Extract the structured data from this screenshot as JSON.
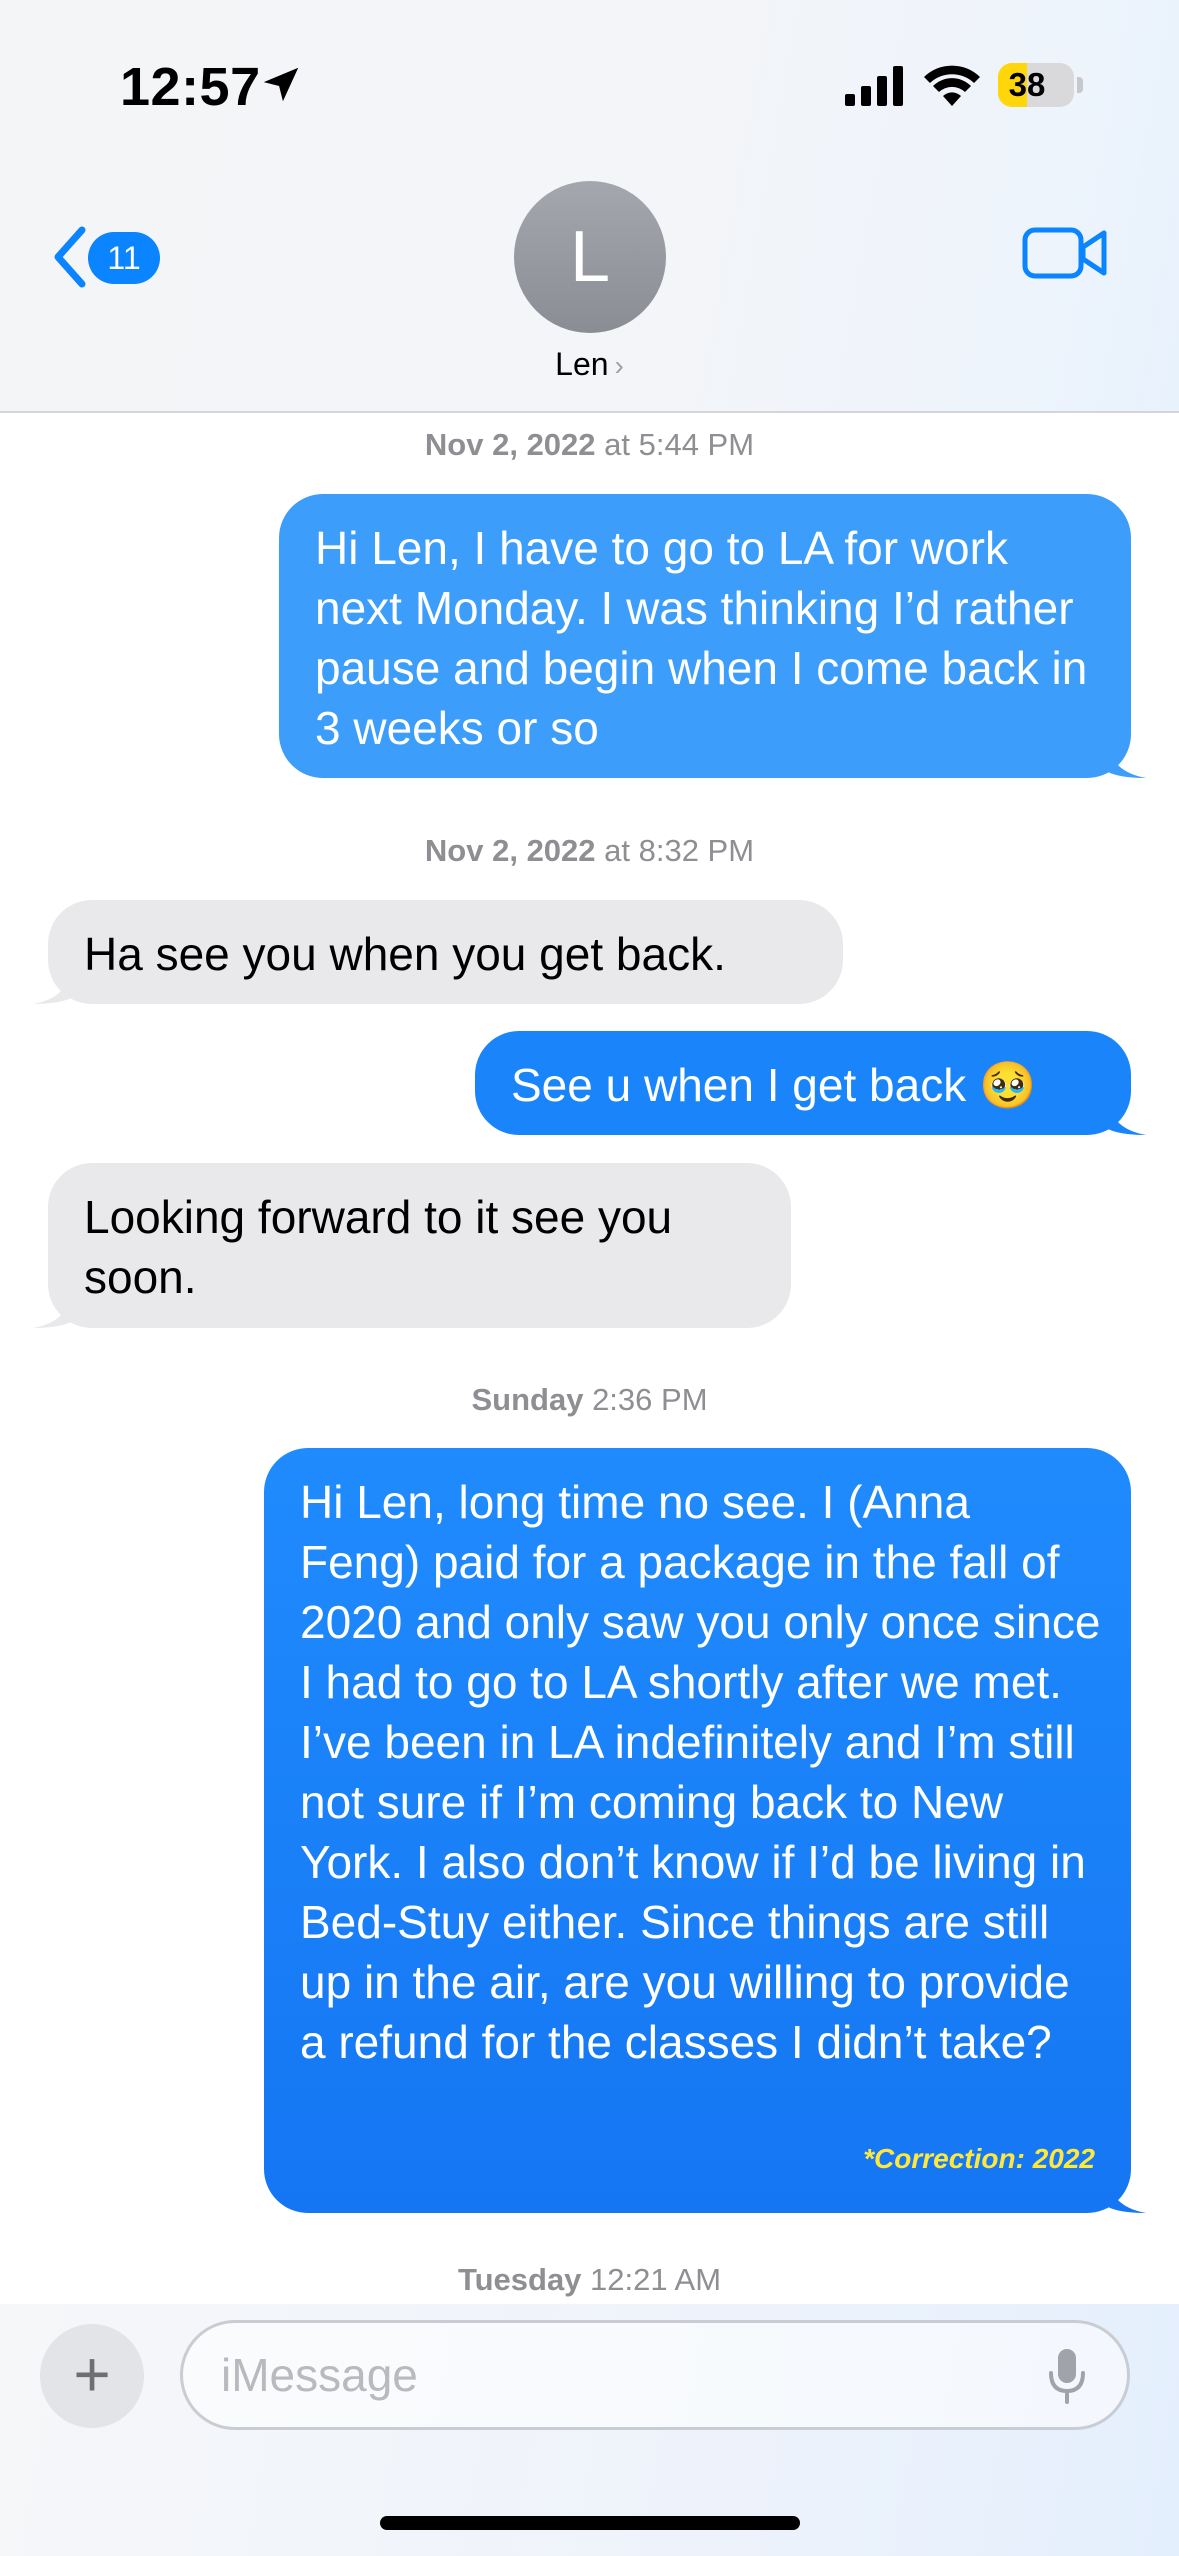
{
  "status_bar": {
    "time": "12:57",
    "battery_level": "38",
    "battery_fraction": 0.38,
    "battery_color": "#ffd60a",
    "icons": [
      "location-arrow-icon",
      "cellular-signal-icon",
      "wifi-icon",
      "battery-icon"
    ]
  },
  "nav": {
    "back_badge_count": "11",
    "contact_initial": "L",
    "contact_name": "Len",
    "contact_chevron": "›",
    "icons": [
      "back-chevron-icon",
      "video-call-icon"
    ]
  },
  "conversation": {
    "ts1_date": "Nov 2, 2022",
    "ts1_time": " at 5:44 PM",
    "msg1": "Hi Len, I have to go to LA for work next Monday. I was thinking I’d rather pause and begin when I come back in 3 weeks or so",
    "ts2_date": "Nov 2, 2022",
    "ts2_time": " at 8:32 PM",
    "msg2": "Ha see you when you get back.",
    "msg3": "See u when I get back 🥹",
    "msg4": "Looking forward to it see you soon.",
    "ts3_day": "Sunday",
    "ts3_time": " 2:36 PM",
    "msg5": "Hi Len, long time no see. I (Anna Feng) paid for a package in the fall of 2020 and only saw you only once since I had to go to LA shortly after we met. I’ve been in LA indefinitely and I’m still not sure if I’m coming back to New York. I also don’t know if I’d be living in Bed-Stuy either. Since things are still up in the air, are you willing to provide a refund for the classes I didn’t take?",
    "msg5_annotation": "*Correction: 2022",
    "ts4_day": "Tuesday",
    "ts4_time": " 12:21 AM"
  },
  "composer": {
    "plus_label": "+",
    "placeholder": "iMessage",
    "value": "",
    "icons": [
      "plus-icon",
      "microphone-icon"
    ]
  },
  "colors": {
    "imessage_blue": "#1a84fb",
    "received_gray": "#e9e9eb",
    "annotation_yellow": "#ffe83d"
  }
}
